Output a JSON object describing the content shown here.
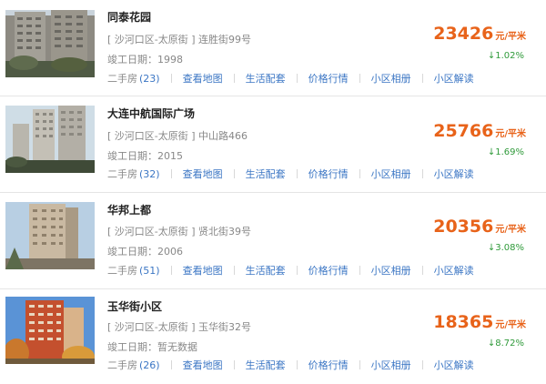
{
  "listings": [
    {
      "name": "同泰花园",
      "address": "[ 沙河口区-太原街 ] 连胜街99号",
      "completion": "竣工日期：1998",
      "price": "23426",
      "unit": "元/平米",
      "change": "↓1.02%",
      "secondhand_label": "二手房",
      "secondhand_count": "(23)",
      "links": [
        "查看地图",
        "生活配套",
        "价格行情",
        "小区相册",
        "小区解读"
      ]
    },
    {
      "name": "大连中航国际广场",
      "address": "[ 沙河口区-太原街 ] 中山路466",
      "completion": "竣工日期：2015",
      "price": "25766",
      "unit": "元/平米",
      "change": "↓1.69%",
      "secondhand_label": "二手房",
      "secondhand_count": "(32)",
      "links": [
        "查看地图",
        "生活配套",
        "价格行情",
        "小区相册",
        "小区解读"
      ]
    },
    {
      "name": "华邦上都",
      "address": "[ 沙河口区-太原街 ] 贤北街39号",
      "completion": "竣工日期：2006",
      "price": "20356",
      "unit": "元/平米",
      "change": "↓3.08%",
      "secondhand_label": "二手房",
      "secondhand_count": "(51)",
      "links": [
        "查看地图",
        "生活配套",
        "价格行情",
        "小区相册",
        "小区解读"
      ]
    },
    {
      "name": "玉华街小区",
      "address": "[ 沙河口区-太原街 ] 玉华街32号",
      "completion": "竣工日期：暂无数据",
      "price": "18365",
      "unit": "元/平米",
      "change": "↓8.72%",
      "secondhand_label": "二手房",
      "secondhand_count": "(26)",
      "links": [
        "查看地图",
        "生活配套",
        "价格行情",
        "小区相册",
        "小区解读"
      ]
    }
  ],
  "colors": {
    "price": "#e8631a",
    "change": "#2f9a3a",
    "link": "#3b76c4",
    "muted": "#888888"
  }
}
